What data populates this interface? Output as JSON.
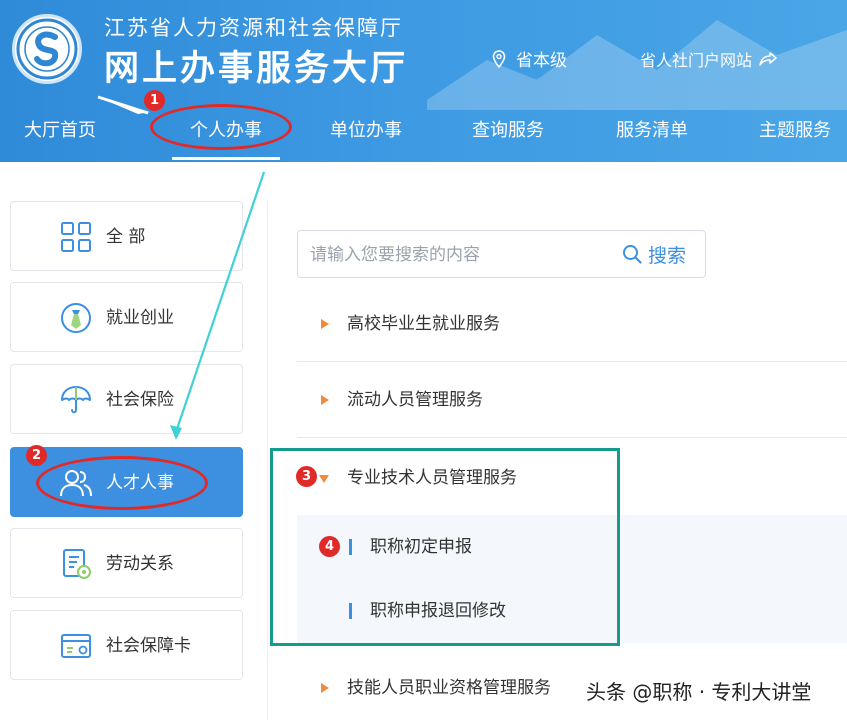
{
  "header": {
    "org_name": "江苏省人力资源和社会保障厅",
    "hall_name": "网上办事服务大厅",
    "region": "省本级",
    "portal_link": "省人社门户网站",
    "logo_icon": "ministry-logo-icon",
    "colors": {
      "header_bg": "#3a95de",
      "text": "#ffffff"
    }
  },
  "nav": {
    "items": [
      {
        "label": "大厅首页"
      },
      {
        "label": "个人办事",
        "active": true
      },
      {
        "label": "单位办事"
      },
      {
        "label": "查询服务"
      },
      {
        "label": "服务清单"
      },
      {
        "label": "主题服务"
      }
    ]
  },
  "sidebar": {
    "items": [
      {
        "label": "全 部",
        "icon": "grid-icon"
      },
      {
        "label": "就业创业",
        "icon": "employment-icon"
      },
      {
        "label": "社会保险",
        "icon": "umbrella-icon"
      },
      {
        "label": "人才人事",
        "icon": "people-icon",
        "active": true
      },
      {
        "label": "劳动关系",
        "icon": "contract-icon"
      },
      {
        "label": "社会保障卡",
        "icon": "card-icon"
      }
    ],
    "colors": {
      "active_bg": "#3d8fe0"
    }
  },
  "search": {
    "placeholder": "请输入您要搜索的内容",
    "button_label": "搜索",
    "icon": "search-icon"
  },
  "categories": [
    {
      "label": "高校毕业生就业服务",
      "expanded": false
    },
    {
      "label": "流动人员管理服务",
      "expanded": false
    },
    {
      "label": "专业技术人员管理服务",
      "expanded": true,
      "children": [
        {
          "label": "职称初定申报"
        },
        {
          "label": "职称申报退回修改"
        }
      ]
    },
    {
      "label": "技能人员职业资格管理服务",
      "expanded": false
    }
  ],
  "annotations": {
    "badges": [
      "1",
      "2",
      "3",
      "4"
    ],
    "colors": {
      "marker": "#e02a2a",
      "box": "#159b8c",
      "arrow": "#3fd1d6"
    }
  },
  "watermark": "头条 @职称 · 专利大讲堂"
}
